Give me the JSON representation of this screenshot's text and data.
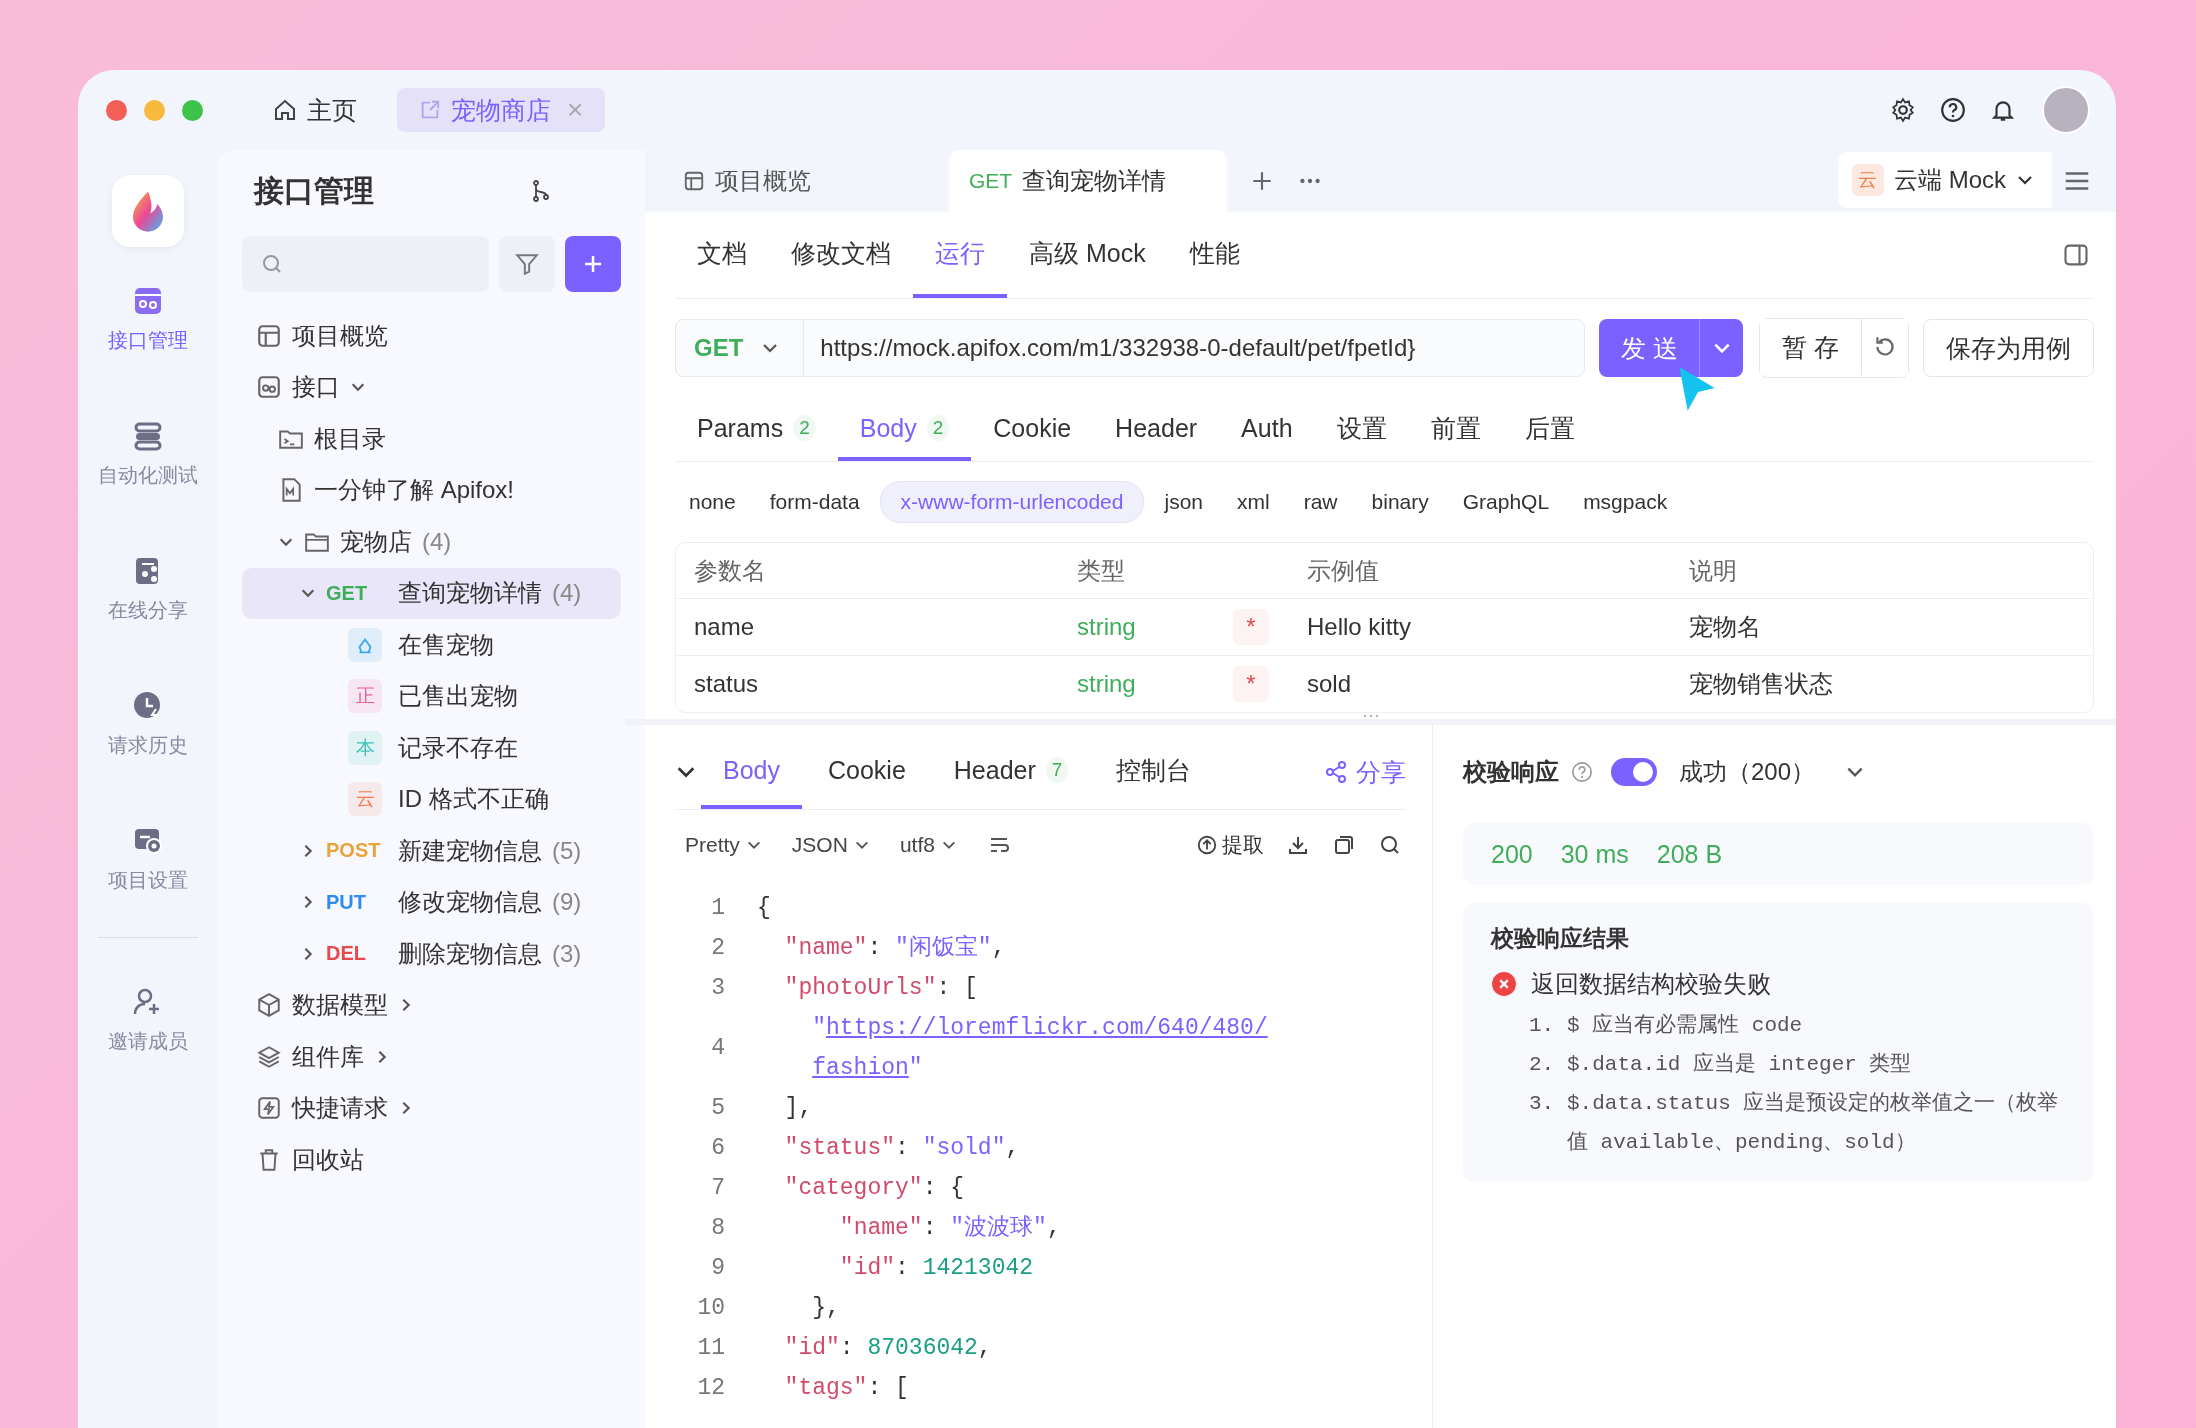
{
  "title_tabs": [
    {
      "kind": "home",
      "label": "主页",
      "selected": false,
      "closable": false
    },
    {
      "kind": "project",
      "label": "宠物商店",
      "selected": true,
      "closable": true
    }
  ],
  "header_actions": {
    "close_glyph": "×"
  },
  "nav_rail": [
    {
      "kind": "api",
      "label": "接口管理",
      "selected": true
    },
    {
      "kind": "test",
      "label": "自动化测试",
      "selected": false
    },
    {
      "kind": "share",
      "label": "在线分享",
      "selected": false
    },
    {
      "kind": "history",
      "label": "请求历史",
      "selected": false
    },
    {
      "kind": "settings",
      "label": "项目设置",
      "selected": false
    },
    {
      "kind": "invite",
      "label": "邀请成员",
      "selected": false
    }
  ],
  "sidebar": {
    "title": "接口管理",
    "tree": [
      {
        "kind": "overview",
        "label": "项目概览",
        "selected": false
      },
      {
        "kind": "group",
        "label": "接口",
        "selected": false,
        "expanded": true,
        "children": [
          {
            "kind": "root",
            "label": "根目录",
            "selected": false
          },
          {
            "kind": "doc",
            "label": "一分钟了解 Apifox!",
            "selected": false
          },
          {
            "kind": "folder",
            "label": "宠物店",
            "count": "(4)",
            "selected": false,
            "expanded": true,
            "children": [
              {
                "kind": "endpoint",
                "method": "GET",
                "label": "查询宠物详情",
                "count": "(4)",
                "selected": true,
                "expanded": true,
                "children": [
                  {
                    "kind": "case",
                    "color": "#3da7f0",
                    "label": "在售宠物",
                    "selected": false
                  },
                  {
                    "kind": "case",
                    "badge": "正",
                    "color": "#e8609f",
                    "label": "已售出宠物",
                    "selected": false
                  },
                  {
                    "kind": "case",
                    "badge": "本",
                    "color": "#40c2b8",
                    "label": "记录不存在",
                    "selected": false
                  },
                  {
                    "kind": "case",
                    "badge": "云",
                    "color": "#ef7d4f",
                    "label": "ID 格式不正确",
                    "selected": false
                  }
                ]
              },
              {
                "kind": "endpoint",
                "method": "POST",
                "label": "新建宠物信息",
                "count": "(5)",
                "selected": false,
                "expanded": false
              },
              {
                "kind": "endpoint",
                "method": "PUT",
                "label": "修改宠物信息",
                "count": "(9)",
                "selected": false,
                "expanded": false
              },
              {
                "kind": "endpoint",
                "method": "DEL",
                "label": "删除宠物信息",
                "count": "(3)",
                "selected": false,
                "expanded": false
              }
            ]
          }
        ]
      },
      {
        "kind": "models",
        "label": "数据模型",
        "selected": false,
        "arrow": true
      },
      {
        "kind": "components",
        "label": "组件库",
        "selected": false,
        "arrow": true
      },
      {
        "kind": "quick",
        "label": "快捷请求",
        "selected": false,
        "arrow": true
      },
      {
        "kind": "trash",
        "label": "回收站",
        "selected": false,
        "arrow": false
      }
    ]
  },
  "doc_tabs": [
    {
      "kind": "overview",
      "label": "项目概览",
      "selected": false
    },
    {
      "kind": "endpoint",
      "method": "GET",
      "label": "查询宠物详情",
      "selected": true
    }
  ],
  "environment": {
    "badge": "云",
    "label": "云端 Mock"
  },
  "mode_tabs": [
    {
      "label": "文档",
      "selected": false
    },
    {
      "label": "修改文档",
      "selected": false
    },
    {
      "label": "运行",
      "selected": true
    },
    {
      "label": "高级 Mock",
      "selected": false
    },
    {
      "label": "性能",
      "selected": false
    }
  ],
  "request": {
    "method": "GET",
    "url": "https://mock.apifox.com/m1/332938-0-default/pet/fpetId}",
    "send": "发 送",
    "save": "暂 存",
    "save_case": "保存为用例"
  },
  "request_tabs": [
    {
      "label": "Params",
      "count": "2",
      "selected": false
    },
    {
      "label": "Body",
      "count": "2",
      "selected": true
    },
    {
      "label": "Cookie",
      "selected": false
    },
    {
      "label": "Header",
      "selected": false
    },
    {
      "label": "Auth",
      "selected": false
    },
    {
      "label": "设置",
      "selected": false
    },
    {
      "label": "前置",
      "selected": false
    },
    {
      "label": "后置",
      "selected": false
    }
  ],
  "body_types": [
    {
      "label": "none",
      "selected": false
    },
    {
      "label": "form-data",
      "selected": false
    },
    {
      "label": "x-www-form-urlencoded",
      "selected": true
    },
    {
      "label": "json",
      "selected": false
    },
    {
      "label": "xml",
      "selected": false
    },
    {
      "label": "raw",
      "selected": false
    },
    {
      "label": "binary",
      "selected": false
    },
    {
      "label": "GraphQL",
      "selected": false
    },
    {
      "label": "msgpack",
      "selected": false
    }
  ],
  "params_table": {
    "columns": [
      "参数名",
      "类型",
      "示例值",
      "说明"
    ],
    "rows": [
      {
        "name": "name",
        "type": "string",
        "required": true,
        "required_mark": "*",
        "example": "Hello kitty",
        "description": "宠物名"
      },
      {
        "name": "status",
        "type": "string",
        "required": true,
        "required_mark": "*",
        "example": "sold",
        "description": "宠物销售状态"
      }
    ]
  },
  "response": {
    "tabs": [
      {
        "label": "Body",
        "selected": true
      },
      {
        "label": "Cookie",
        "selected": false
      },
      {
        "label": "Header",
        "count": "7",
        "selected": false
      },
      {
        "label": "控制台",
        "selected": false
      }
    ],
    "share": "分享",
    "formats": [
      "Pretty",
      "JSON",
      "utf8"
    ],
    "extract": "提取",
    "code": [
      {
        "number": "1",
        "tokens": [
          {
            "kind": "punct",
            "text": "{"
          }
        ]
      },
      {
        "number": "2",
        "tokens": [
          {
            "kind": "key",
            "text": "  \"name\""
          },
          {
            "kind": "punct",
            "text": ": "
          },
          {
            "kind": "str",
            "text": "\"闲饭宝\""
          },
          {
            "kind": "punct",
            "text": ","
          }
        ]
      },
      {
        "number": "3",
        "tokens": [
          {
            "kind": "key",
            "text": "  \"photoUrls\""
          },
          {
            "kind": "punct",
            "text": ": ["
          }
        ]
      },
      {
        "number": "4",
        "tokens": [
          {
            "kind": "str",
            "text": "    \""
          },
          {
            "kind": "link",
            "text": "https://loremflickr.com/640/480/fashion"
          },
          {
            "kind": "str",
            "text": "\""
          }
        ]
      },
      {
        "number": "5",
        "tokens": [
          {
            "kind": "punct",
            "text": "  ],"
          }
        ]
      },
      {
        "number": "6",
        "tokens": [
          {
            "kind": "key",
            "text": "  \"status\""
          },
          {
            "kind": "punct",
            "text": ": "
          },
          {
            "kind": "str",
            "text": "\"sold\""
          },
          {
            "kind": "punct",
            "text": ","
          }
        ]
      },
      {
        "number": "7",
        "tokens": [
          {
            "kind": "key",
            "text": "  \"category\""
          },
          {
            "kind": "punct",
            "text": ": {"
          }
        ]
      },
      {
        "number": "8",
        "tokens": [
          {
            "kind": "key",
            "text": "      \"name\""
          },
          {
            "kind": "punct",
            "text": ": "
          },
          {
            "kind": "str",
            "text": "\"波波球\""
          },
          {
            "kind": "punct",
            "text": ","
          }
        ]
      },
      {
        "number": "9",
        "tokens": [
          {
            "kind": "key",
            "text": "      \"id\""
          },
          {
            "kind": "punct",
            "text": ": "
          },
          {
            "kind": "num",
            "text": "14213042"
          }
        ]
      },
      {
        "number": "10",
        "tokens": [
          {
            "kind": "punct",
            "text": "    },"
          }
        ]
      },
      {
        "number": "11",
        "tokens": [
          {
            "kind": "key",
            "text": "  \"id\""
          },
          {
            "kind": "punct",
            "text": ": "
          },
          {
            "kind": "num",
            "text": "87036042"
          },
          {
            "kind": "punct",
            "text": ","
          }
        ]
      },
      {
        "number": "12",
        "tokens": [
          {
            "kind": "key",
            "text": "  \"tags\""
          },
          {
            "kind": "punct",
            "text": ": ["
          }
        ]
      }
    ]
  },
  "validation": {
    "label": "校验响应",
    "enabled": true,
    "status": "成功（200）",
    "metrics": [
      "200",
      "30 ms",
      "208 B"
    ],
    "result_title": "校验响应结果",
    "error": "返回数据结构校验失败",
    "issues": [
      {
        "number": "1.",
        "text": "$ 应当有必需属性 code"
      },
      {
        "number": "2.",
        "text": "$.data.id 应当是 integer 类型"
      },
      {
        "number": "3.",
        "text": "$.data.status 应当是预设定的枚举值之一（枚举值 available、pending、sold）"
      }
    ]
  }
}
